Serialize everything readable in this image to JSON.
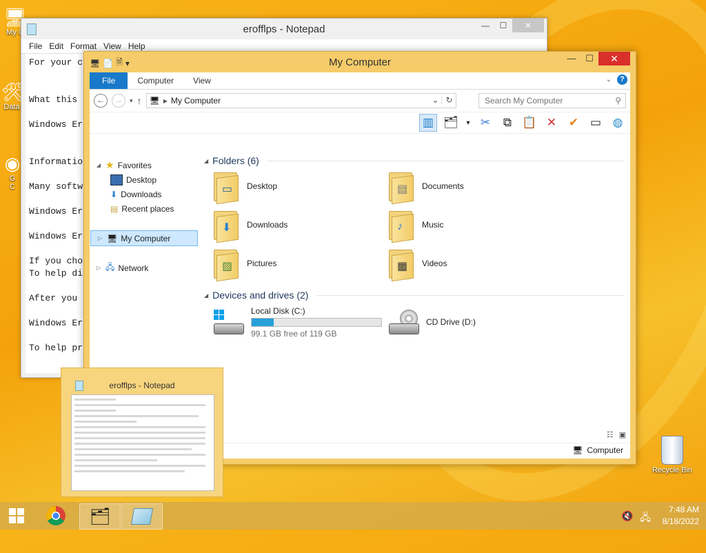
{
  "desktop": {
    "icons": [
      "My C",
      "Data",
      "G",
      "C"
    ],
    "recycle_bin": "Recycle Bin"
  },
  "notepad": {
    "title": "erofflps - Notepad",
    "menu": [
      "File",
      "Edit",
      "Format",
      "View",
      "Help"
    ],
    "lines": [
      "For your c",
      "",
      "",
      "What this ",
      "",
      "Windows Er",
      "",
      "",
      "Informatio",
      "",
      "Many softw",
      "",
      "Windows Er",
      "",
      "Windows Er",
      "",
      "If you cho",
      "To help di",
      "",
      "After you ",
      "",
      "Windows Er",
      "",
      "To help pr"
    ]
  },
  "explorer": {
    "title": "My Computer",
    "tabs": [
      "File",
      "Computer",
      "View"
    ],
    "address": "My Computer",
    "search_placeholder": "Search My Computer",
    "nav": {
      "favorites": "Favorites",
      "desktop": "Desktop",
      "downloads": "Downloads",
      "recent": "Recent places",
      "my_computer": "My Computer",
      "network": "Network"
    },
    "folders_header": "Folders (6)",
    "folders": [
      {
        "name": "Desktop"
      },
      {
        "name": "Documents"
      },
      {
        "name": "Downloads"
      },
      {
        "name": "Music"
      },
      {
        "name": "Pictures"
      },
      {
        "name": "Videos"
      }
    ],
    "devices_header": "Devices and drives (2)",
    "drives": [
      {
        "name": "Local Disk (C:)",
        "free": "99.1 GB free of 119 GB",
        "used_fraction": 0.17
      },
      {
        "name": "CD Drive (D:)"
      }
    ],
    "status_computer": "Computer"
  },
  "thumbnail": {
    "title": "erofflps - Notepad"
  },
  "taskbar": {
    "time": "7:48 AM",
    "date": "8/18/2022"
  },
  "colors": {
    "accent": "#1979ca",
    "close": "#d9302c",
    "drive_bar": "#26a0da"
  }
}
